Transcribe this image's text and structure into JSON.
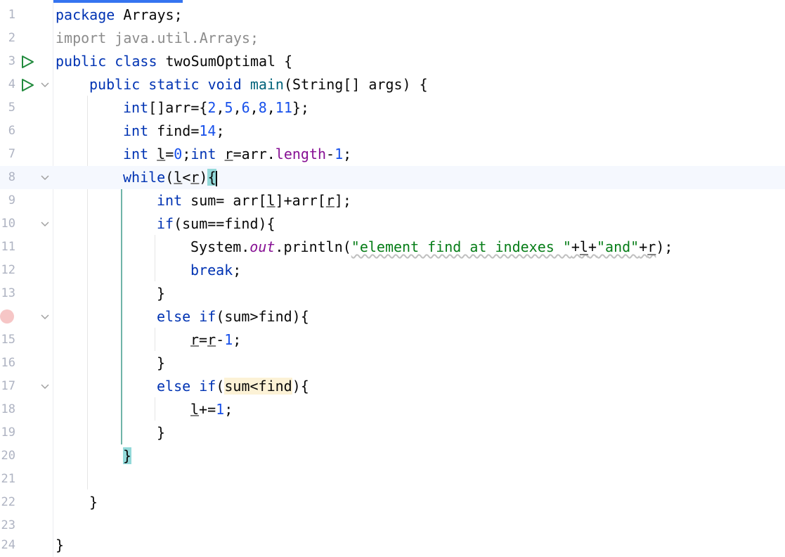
{
  "editor": {
    "line_numbers": [
      "1",
      "2",
      "3",
      "4",
      "5",
      "6",
      "7",
      "8",
      "9",
      "10",
      "11",
      "12",
      "13",
      "",
      "15",
      "16",
      "17",
      "18",
      "19",
      "20",
      "21",
      "22",
      "23",
      "24"
    ],
    "lines": {
      "l1": {
        "kw": "package",
        "rest": " Arrays;"
      },
      "l2": {
        "text": "import java.util.Arrays;"
      },
      "l3": {
        "kw1": "public",
        "kw2": "class",
        "name": " twoSumOptimal {"
      },
      "l4": {
        "kw1": "public",
        "kw2": "static",
        "kw3": "void",
        "fn": "main",
        "rest": "(String[] args) {"
      },
      "l5": {
        "kw": "int",
        "a": "[]arr={",
        "n1": "2",
        "n2": "5",
        "n3": "6",
        "n4": "8",
        "n5": "11",
        "b": "};"
      },
      "l6": {
        "kw": "int",
        "a": " find=",
        "n": "14",
        "b": ";"
      },
      "l7": {
        "kw1": "int",
        "v1": "l",
        "eq": "=",
        "n0": "0",
        "semi": ";",
        "kw2": "int",
        "v2": "r",
        "mid": "=arr.",
        "field": "length",
        "minus": "-",
        "n1": "1",
        "end": ";"
      },
      "l8": {
        "kw": "while",
        "open": "(",
        "v1": "l",
        "lt": "<",
        "v2": "r",
        "close": ")",
        "brace": "{"
      },
      "l9": {
        "kw": "int",
        "a": " sum= arr[",
        "v1": "l",
        "b": "]+arr[",
        "v2": "r",
        "c": "];"
      },
      "l10": {
        "kw": "if",
        "rest": "(sum==find){"
      },
      "l11": {
        "a": "System.",
        "static": "out",
        "b": ".println(",
        "s1": "\"element find at indexes \"",
        "p1": "+",
        "v1": "l",
        "p2": "+",
        "s2": "\"and\"",
        "p3": "+",
        "v2": "r",
        "c": ");"
      },
      "l12": {
        "kw": "break",
        "rest": ";"
      },
      "l13": {
        "text": "}"
      },
      "l14": {
        "kw1": "else",
        "kw2": "if",
        "rest": "(sum>find){"
      },
      "l15": {
        "v1": "r",
        "eq": "=",
        "v2": "r",
        "minus": "-",
        "n": "1",
        "end": ";"
      },
      "l16": {
        "text": "}"
      },
      "l17": {
        "kw1": "else",
        "kw2": "if",
        "open": "(",
        "cond": "sum<find",
        "rest": "){"
      },
      "l18": {
        "v": "l",
        "op": "+=",
        "n": "1",
        "end": ";"
      },
      "l19": {
        "text": "}"
      },
      "l20": {
        "text": "}"
      },
      "l22": {
        "text": "}"
      },
      "l24": {
        "text": "}"
      }
    }
  }
}
